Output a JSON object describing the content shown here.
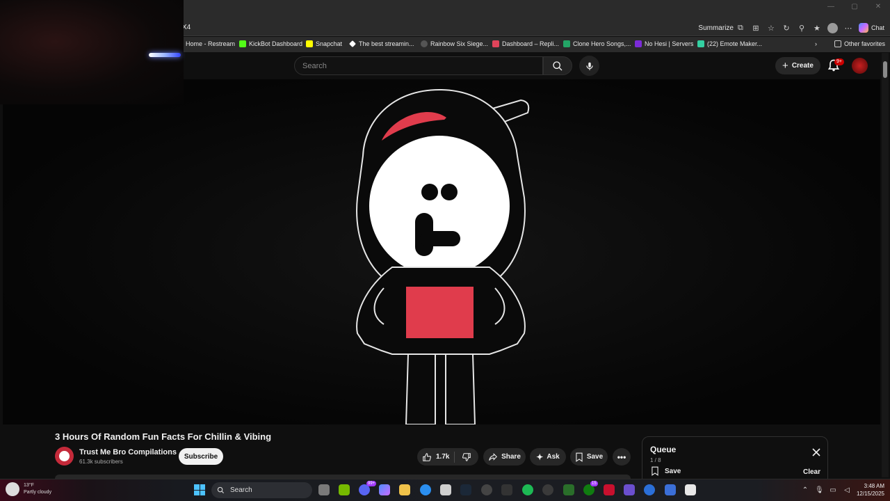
{
  "browser": {
    "url_fragment": "X4",
    "summarize_label": "Summarize",
    "chat_label": "Chat",
    "bookmarks": [
      {
        "label": "Home - Restream",
        "color": "#1e6bff"
      },
      {
        "label": "KickBot Dashboard",
        "color": "#53fc18"
      },
      {
        "label": "Snapchat",
        "color": "#fffc00"
      },
      {
        "label": "The best streamin...",
        "color": "#ffffff"
      },
      {
        "label": "Rainbow Six Siege...",
        "color": "#cccccc"
      },
      {
        "label": "Dashboard – Repli...",
        "color": "#e0445a"
      },
      {
        "label": "Clone Hero Songs,...",
        "color": "#23a566"
      },
      {
        "label": "No Hesi | Servers",
        "color": "#7b2bd8"
      },
      {
        "label": "(22) Emote Maker...",
        "color": "#34d0a2"
      }
    ],
    "other_favorites": "Other favorites"
  },
  "youtube": {
    "search_placeholder": "Search",
    "create_label": "Create",
    "notification_badge": "9+"
  },
  "video": {
    "title": "3 Hours Of Random Fun Facts For Chillin & Vibing",
    "channel_name": "Trust Me Bro Compilations",
    "subscribers": "61.3k subscribers",
    "subscribe_label": "Subscribe",
    "likes": "1.7k",
    "share_label": "Share",
    "ask_label": "Ask",
    "save_label": "Save"
  },
  "queue": {
    "title": "Queue",
    "count": "1 / 8",
    "save_label": "Save",
    "clear_label": "Clear"
  },
  "taskbar": {
    "temperature": "13°F",
    "weather": "Partly cloudy",
    "search_label": "Search",
    "time": "3:48 AM",
    "date": "12/15/2025",
    "badge_a": "99+",
    "badge_b": "15"
  },
  "colors": {
    "accent_red": "#e03c4c",
    "bg": "#0f0f0f",
    "pill": "#272727"
  }
}
